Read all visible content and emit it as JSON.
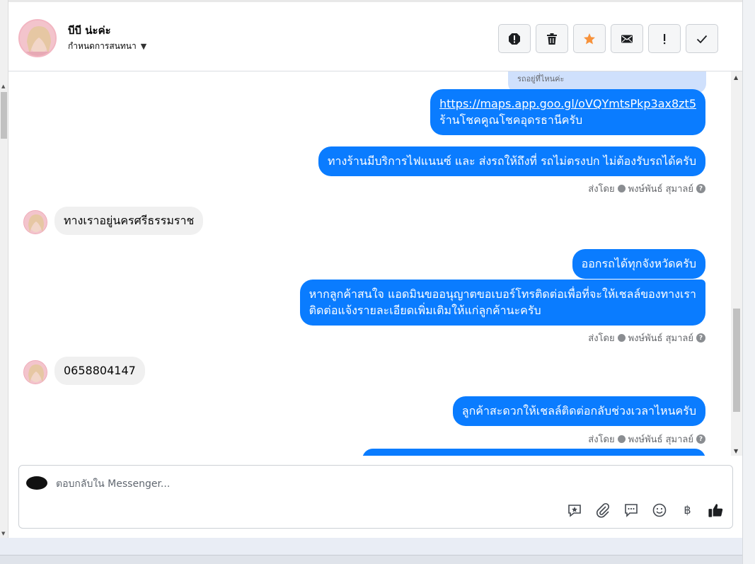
{
  "header": {
    "contact_name": "บีบี น่ะค่ะ",
    "assign_label": "กำหนดการสนทนา"
  },
  "toolbar": {
    "buttons": [
      "spam-icon",
      "trash-icon",
      "star-icon",
      "envelope-icon",
      "exclamation-icon",
      "check-icon"
    ],
    "star_color": "#f7923b"
  },
  "conversation": {
    "reply_preview": "รถอยู่ที่ไหนค่ะ",
    "messages": [
      {
        "link": "https://maps.app.goo.gl/oVQYmtsPkp3ax8zt5",
        "text": "ร้านโชคคูณโชคอุดรธานีครับ"
      },
      {
        "text": "ทางร้านมีบริการไฟแนนซ์ และ ส่งรถให้ถึงที่ รถไม่ตรงปก ไม่ต้องรับรถได้ครับ"
      },
      {
        "text": "ทางเราอยู่นครศรีธรรมราช"
      },
      {
        "text": "ออกรถได้ทุกจังหวัดครับ"
      },
      {
        "line1": "หากลูกค้าสนใจ แอดมินขออนุญาตขอเบอร์โทรติดต่อเพื่อที่จะให้เชลล์ของทางเรา",
        "line2": "ติดต่อแจ้งรายละเอียดเพิ่มเติมให้แก่ลูกค้านะครับ"
      },
      {
        "text": "0658804147"
      },
      {
        "text": "ลูกค้าสะดวกให้เชลล์ติดต่อกลับช่วงเวลาไหนครับ"
      }
    ],
    "sent_by_prefix": "ส่งโดย",
    "sent_by_name": "พงษ์พันธ์ สุมาลย์"
  },
  "composer": {
    "placeholder": "ตอบกลับใน Messenger...",
    "icons": [
      "sticker-icon",
      "attachment-icon",
      "saved-reply-icon",
      "emoji-icon",
      "baht-icon",
      "like-icon"
    ],
    "baht_glyph": "฿",
    "like_color": "#1c1e21"
  },
  "colors": {
    "outgoing_bubble": "#0a7cff",
    "incoming_bubble": "#f0f0f0"
  }
}
